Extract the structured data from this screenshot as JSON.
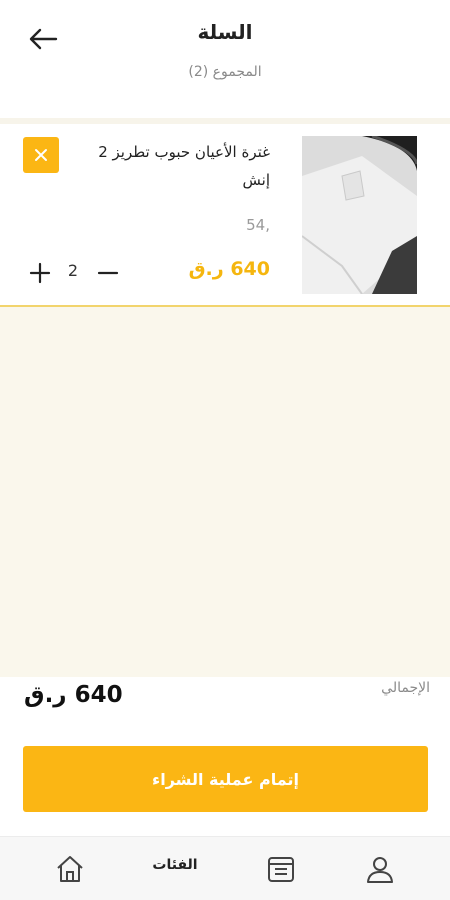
{
  "header": {
    "title": "السلة",
    "subtitle": "المجموع (2)"
  },
  "cart": {
    "items": [
      {
        "name": "غترة الأعيان حبوب تطريز 2 إنش",
        "code": "54,",
        "price": "640 ر.ق",
        "quantity": "2"
      }
    ]
  },
  "summary": {
    "total_label": "الإجمالي",
    "total_value": "640 ر.ق"
  },
  "checkout": {
    "label": "إتمام عملية الشراء"
  },
  "nav": {
    "categories_label": "الفئات"
  },
  "colors": {
    "accent": "#fbb614",
    "price": "#f5b60f",
    "empty_background": "#faf7ec"
  },
  "icons": [
    "back-arrow-icon",
    "close-icon",
    "plus-icon",
    "minus-icon",
    "home-icon",
    "orders-icon",
    "profile-icon"
  ]
}
